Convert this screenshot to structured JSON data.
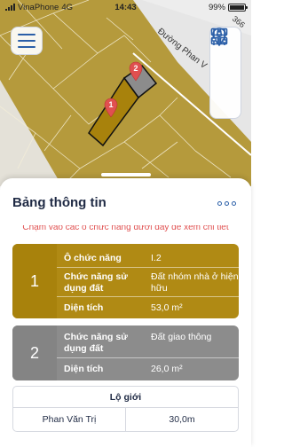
{
  "status_bar": {
    "carrier": "VinaPhone",
    "network": "4G",
    "time": "14:43",
    "battery": "99%"
  },
  "map": {
    "street_label": "Đường Phan V",
    "side_label": "366",
    "markers": [
      {
        "label": "2",
        "color": "#e05050"
      },
      {
        "label": "1",
        "color": "#e05050"
      }
    ],
    "land_color": "#b59a3c",
    "road_color": "#e8e8e8",
    "icons": [
      "menu-icon",
      "grid-icon",
      "location-pin-icon",
      "sliders-icon"
    ]
  },
  "sheet": {
    "title": "Bảng thông tin",
    "more_icon": "more-icon",
    "hint": "Chạm vào các ô chức năng dưới đây để xem chi tiết"
  },
  "cards": [
    {
      "number": "1",
      "color": "#b08a14",
      "function_label": "Ô chức năng",
      "function_value": "I.2",
      "usage_label": "Chức năng sử dụng đất",
      "usage_value": "Đất nhóm nhà ở hiện hữu",
      "area_label": "Diện tích",
      "area_value": "53,0 m²"
    },
    {
      "number": "2",
      "color": "#8c8c8c",
      "usage_label": "Chức năng sử dụng đất",
      "usage_value": "Đất giao thông",
      "area_label": "Diện tích",
      "area_value": "26,0 m²"
    }
  ],
  "lo_gioi": {
    "title": "Lộ giới",
    "street": "Phan Văn Trị",
    "width": "30,0m"
  }
}
